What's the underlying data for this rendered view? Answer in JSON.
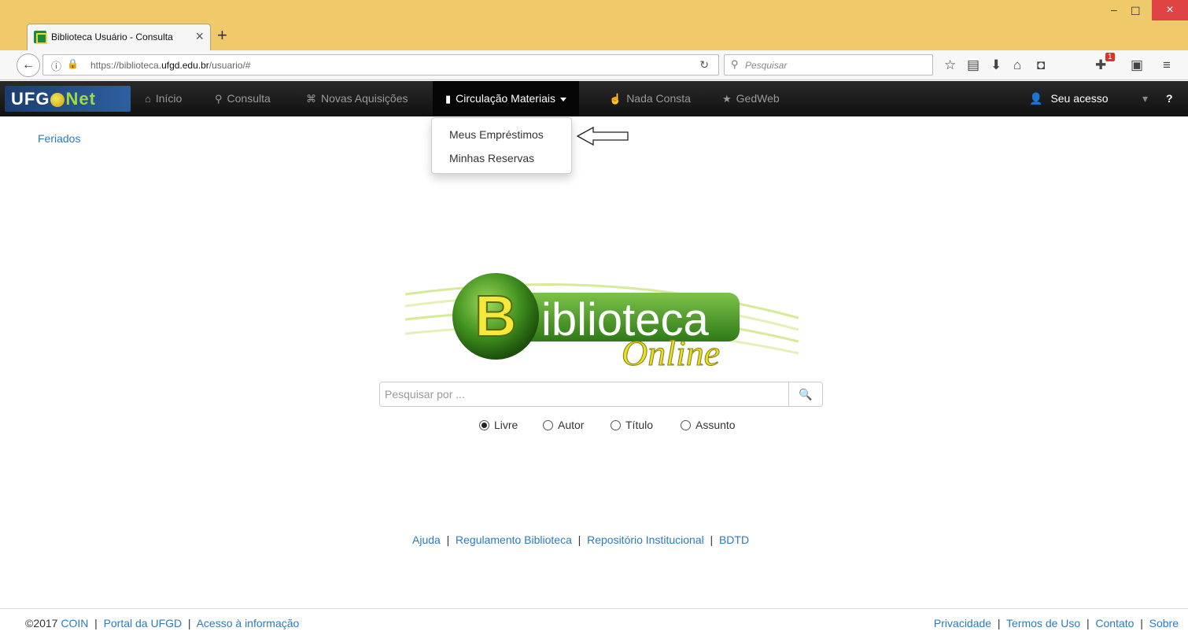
{
  "browser": {
    "tab_title": "Biblioteca Usuário - Consulta",
    "url_prefix": "https://biblioteca.",
    "url_host": "ufgd.edu.br",
    "url_path": "/usuario/#",
    "search_placeholder": "Pesquisar",
    "notification_count": "1"
  },
  "sitenav": {
    "logo_left": "UFG",
    "logo_right": "Net",
    "items": [
      {
        "label": "Início",
        "icon": "home-icon"
      },
      {
        "label": "Consulta",
        "icon": "search-icon"
      },
      {
        "label": "Novas Aquisições",
        "icon": "gift-icon"
      },
      {
        "label": "Circulação Materiais",
        "icon": "book-icon"
      },
      {
        "label": "Nada Consta",
        "icon": "thumbs-up-icon"
      },
      {
        "label": "GedWeb",
        "icon": "star-icon"
      }
    ],
    "account_label": "Seu acesso",
    "help_label": "?"
  },
  "dropdown": {
    "items": [
      "Meus Empréstimos",
      "Minhas Reservas"
    ]
  },
  "sidebar": {
    "feriados": "Feriados"
  },
  "logo": {
    "initial": "B",
    "word": "iblioteca",
    "script": "Online"
  },
  "search": {
    "placeholder": "Pesquisar por ...",
    "options": [
      "Livre",
      "Autor",
      "Título",
      "Assunto"
    ],
    "selected": "Livre"
  },
  "links": [
    "Ajuda",
    "Regulamento Biblioteca",
    "Repositório Institucional",
    "BDTD"
  ],
  "footer": {
    "copyright": "©2017",
    "left_links": [
      "COIN",
      "Portal da UFGD",
      "Acesso à informação"
    ],
    "right_links": [
      "Privacidade",
      "Termos de Uso",
      "Contato",
      "Sobre"
    ]
  },
  "colors": {
    "link": "#2a7bc0",
    "navbar": "#1a1a1a",
    "titlebar": "#f0c96a"
  }
}
